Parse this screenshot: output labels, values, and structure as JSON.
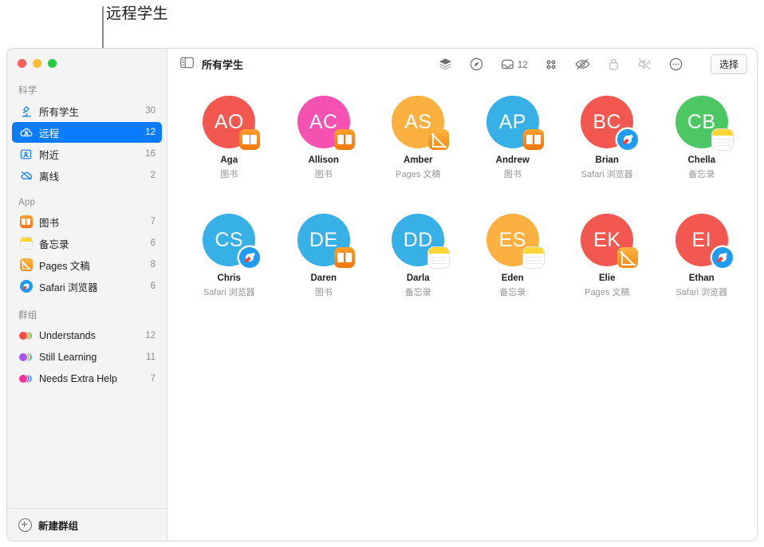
{
  "callout": {
    "label": "远程学生"
  },
  "window": {
    "traffic_lights": [
      "close",
      "minimize",
      "zoom"
    ]
  },
  "sidebar": {
    "sections": [
      {
        "title": "科学",
        "items": [
          {
            "label": "所有学生",
            "count": "30",
            "icon": "microscope-icon",
            "selected": false
          },
          {
            "label": "远程",
            "count": "12",
            "icon": "cloud-person-icon",
            "selected": true
          },
          {
            "label": "附近",
            "count": "16",
            "icon": "person-frame-icon",
            "selected": false
          },
          {
            "label": "离线",
            "count": "2",
            "icon": "cloud-slash-icon",
            "selected": false
          }
        ]
      },
      {
        "title": "App",
        "items": [
          {
            "label": "图书",
            "count": "7",
            "icon": "books-app-icon",
            "selected": false
          },
          {
            "label": "备忘录",
            "count": "6",
            "icon": "notes-app-icon",
            "selected": false
          },
          {
            "label": "Pages 文稿",
            "count": "8",
            "icon": "pages-app-icon",
            "selected": false
          },
          {
            "label": "Safari 浏览器",
            "count": "6",
            "icon": "safari-app-icon",
            "selected": false
          }
        ]
      },
      {
        "title": "群组",
        "items": [
          {
            "label": "Understands",
            "count": "12",
            "icon": "group-avatars-icon",
            "selected": false,
            "colors": [
              "#f2504b",
              "#ff9f2e",
              "#4cc764"
            ]
          },
          {
            "label": "Still Learning",
            "count": "11",
            "icon": "group-avatars-icon",
            "selected": false,
            "colors": [
              "#a855f7",
              "#ffb340",
              "#3aafe8"
            ]
          },
          {
            "label": "Needs Extra Help",
            "count": "7",
            "icon": "group-avatars-icon",
            "selected": false,
            "colors": [
              "#ff2d9b",
              "#8b5cf6",
              "#3aafe8"
            ]
          }
        ]
      }
    ],
    "new_group_label": "新建群组"
  },
  "toolbar": {
    "sidebar_toggle_icon": "sidebar-toggle-icon",
    "title": "所有学生",
    "items": [
      {
        "icon": "layers-icon",
        "label": "",
        "dimmed": false
      },
      {
        "icon": "compass-navigate-icon",
        "label": "",
        "dimmed": false
      },
      {
        "icon": "inbox-icon",
        "label": "12",
        "dimmed": false
      },
      {
        "icon": "grid-apps-icon",
        "label": "",
        "dimmed": false
      },
      {
        "icon": "eye-slash-icon",
        "label": "",
        "dimmed": false
      },
      {
        "icon": "lock-icon",
        "label": "",
        "dimmed": true
      },
      {
        "icon": "speaker-mute-icon",
        "label": "",
        "dimmed": true
      },
      {
        "icon": "ellipsis-circle-icon",
        "label": "",
        "dimmed": false
      }
    ],
    "select_button": "选择"
  },
  "students": [
    {
      "initials": "AO",
      "name": "Aga",
      "app": "图书",
      "color": "#f2584f",
      "badge": "books"
    },
    {
      "initials": "AC",
      "name": "Allison",
      "app": "图书",
      "color": "#f451b0",
      "badge": "books"
    },
    {
      "initials": "AS",
      "name": "Amber",
      "app": "Pages 文稿",
      "color": "#fbb champion",
      "badge": "pages"
    },
    {
      "initials": "AP",
      "name": "Andrew",
      "app": "图书",
      "color": "#37b0e8",
      "badge": "books"
    },
    {
      "initials": "BC",
      "name": "Brian",
      "app": "Safari 浏览器",
      "color": "#f2584f",
      "badge": "safari"
    },
    {
      "initials": "CB",
      "name": "Chella",
      "app": "备忘录",
      "color": "#4cc764",
      "badge": "notes"
    },
    {
      "initials": "CS",
      "name": "Chris",
      "app": "Safari 浏览器",
      "color": "#37b0e8",
      "badge": "safari"
    },
    {
      "initials": "DE",
      "name": "Daren",
      "app": "图书",
      "color": "#37b0e8",
      "badge": "books"
    },
    {
      "initials": "DD",
      "name": "Darla",
      "app": "备忘录",
      "color": "#37b0e8",
      "badge": "notes"
    },
    {
      "initials": "ES",
      "name": "Eden",
      "app": "备忘录",
      "color": "#fbb040",
      "badge": "notes"
    },
    {
      "initials": "EK",
      "name": "Elie",
      "app": "Pages 文稿",
      "color": "#f2584f",
      "badge": "pages"
    },
    {
      "initials": "EI",
      "name": "Ethan",
      "app": "Safari 浏览器",
      "color": "#f2584f",
      "badge": "safari"
    }
  ],
  "colors": {
    "accent": "#0a7cff",
    "sidebar_bg": "#f4f4f4",
    "main_bg": "#ffffff",
    "secondary_text": "#8a8a8e"
  }
}
